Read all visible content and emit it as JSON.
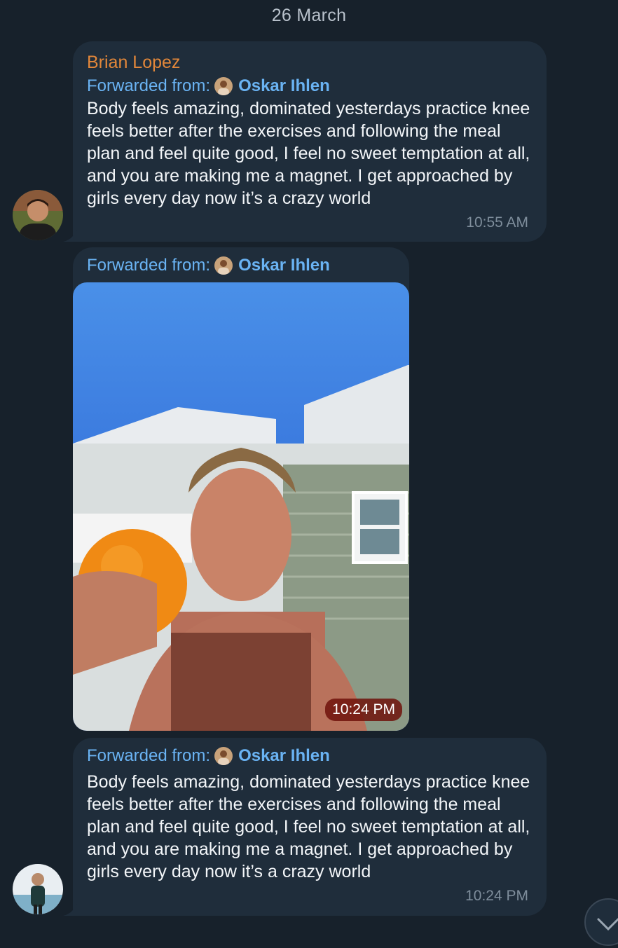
{
  "date_separator": "26 March",
  "messages": [
    {
      "sender": "Brian Lopez",
      "forwarded_label": "Forwarded from:",
      "forwarded_name": "Oskar Ihlen",
      "text": "Body feels amazing, dominated yesterdays practice knee feels better after the exercises and following the meal plan and feel quite good, I feel no sweet temptation at all, and you are making me a magnet. I get approached by girls every day now it’s a crazy world",
      "time": "10:55 AM"
    },
    {
      "forwarded_label": "Forwarded from:",
      "forwarded_name": "Oskar Ihlen",
      "media": "photo",
      "time": "10:24 PM"
    },
    {
      "forwarded_label": "Forwarded from:",
      "forwarded_name": "Oskar Ihlen",
      "text": "Body feels amazing, dominated yesterdays practice knee feels better after the exercises and following the meal plan and feel quite good, I feel no sweet temptation at all, and you are making me a magnet. I get approached by girls every day now it’s a crazy world",
      "time": "10:24 PM"
    }
  ],
  "colors": {
    "background": "#17212b",
    "bubble": "#1f2d3b",
    "sender_name": "#e2873a",
    "link": "#6ab3f3",
    "time": "#7f8e9c"
  },
  "icons": {
    "scroll_down": "chevron-down-icon"
  }
}
